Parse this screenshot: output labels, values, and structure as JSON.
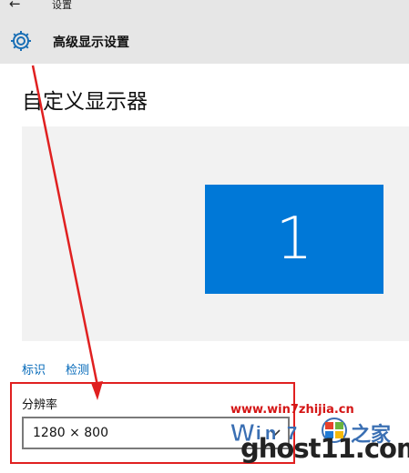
{
  "window": {
    "back_icon": "back-arrow-icon",
    "title": "设置"
  },
  "header": {
    "icon": "gear-icon",
    "title": "高级显示设置"
  },
  "page": {
    "title": "自定义显示器"
  },
  "display_preview": {
    "monitor_label": "1",
    "monitor_color": "#0078d7"
  },
  "links": {
    "identify": "标识",
    "detect": "检测"
  },
  "resolution": {
    "label": "分辨率",
    "value": "1280 × 800"
  },
  "annotation": {
    "color": "#e02020"
  },
  "watermark": {
    "url": "www.win7zhijia.cn",
    "brand": "ghost11.com",
    "logo_letter": "W"
  }
}
